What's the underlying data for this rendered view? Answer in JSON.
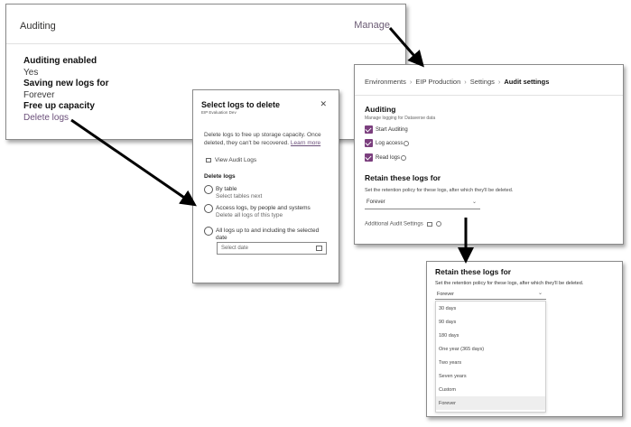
{
  "auditing_panel": {
    "title": "Auditing",
    "manage_link": "Manage",
    "fields": [
      {
        "label": "Auditing enabled",
        "value": "Yes"
      },
      {
        "label": "Saving new logs for",
        "value": "Forever"
      }
    ],
    "free_up_label": "Free up capacity",
    "delete_logs_link": "Delete logs"
  },
  "delete_dialog": {
    "title": "Select logs to delete",
    "subtitle": "EIP Evaluation Dev",
    "close_icon": "close-icon",
    "description": "Delete logs to free up storage capacity. Once deleted, they can't be recovered.",
    "learn_more": "Learn more",
    "view_audit_logs": "View Audit Logs",
    "delete_logs_heading": "Delete logs",
    "options": [
      {
        "label": "By table",
        "hint": "Select tables next"
      },
      {
        "label": "Access logs, by people and systems",
        "hint": "Delete all logs of this type"
      },
      {
        "label": "All logs up to and including the selected date",
        "hint": ""
      }
    ],
    "date_placeholder": "Select date"
  },
  "audit_settings": {
    "breadcrumb": [
      "Environments",
      "EIP Production",
      "Settings",
      "Audit settings"
    ],
    "auditing_title": "Auditing",
    "auditing_subtitle": "Manage logging for Dataverse data",
    "checkboxes": [
      {
        "label": "Start Auditing",
        "checked": true
      },
      {
        "label": "Log access",
        "checked": true
      },
      {
        "label": "Read logs",
        "checked": true
      }
    ],
    "retain_title": "Retain these logs for",
    "retain_desc": "Set the retention policy for these logs, after which they'll be deleted.",
    "retain_value": "Forever",
    "additional_settings": "Additional Audit Settings"
  },
  "retention_dropdown": {
    "title": "Retain these logs for",
    "desc": "Set the retention policy for these logs, after which they'll be deleted.",
    "selected": "Forever",
    "options": [
      "30 days",
      "90 days",
      "180 days",
      "One year (365 days)",
      "Two years",
      "Seven years",
      "Custom",
      "Forever"
    ]
  },
  "colors": {
    "accent": "#7b3f7e",
    "link": "#6b4f7a"
  }
}
